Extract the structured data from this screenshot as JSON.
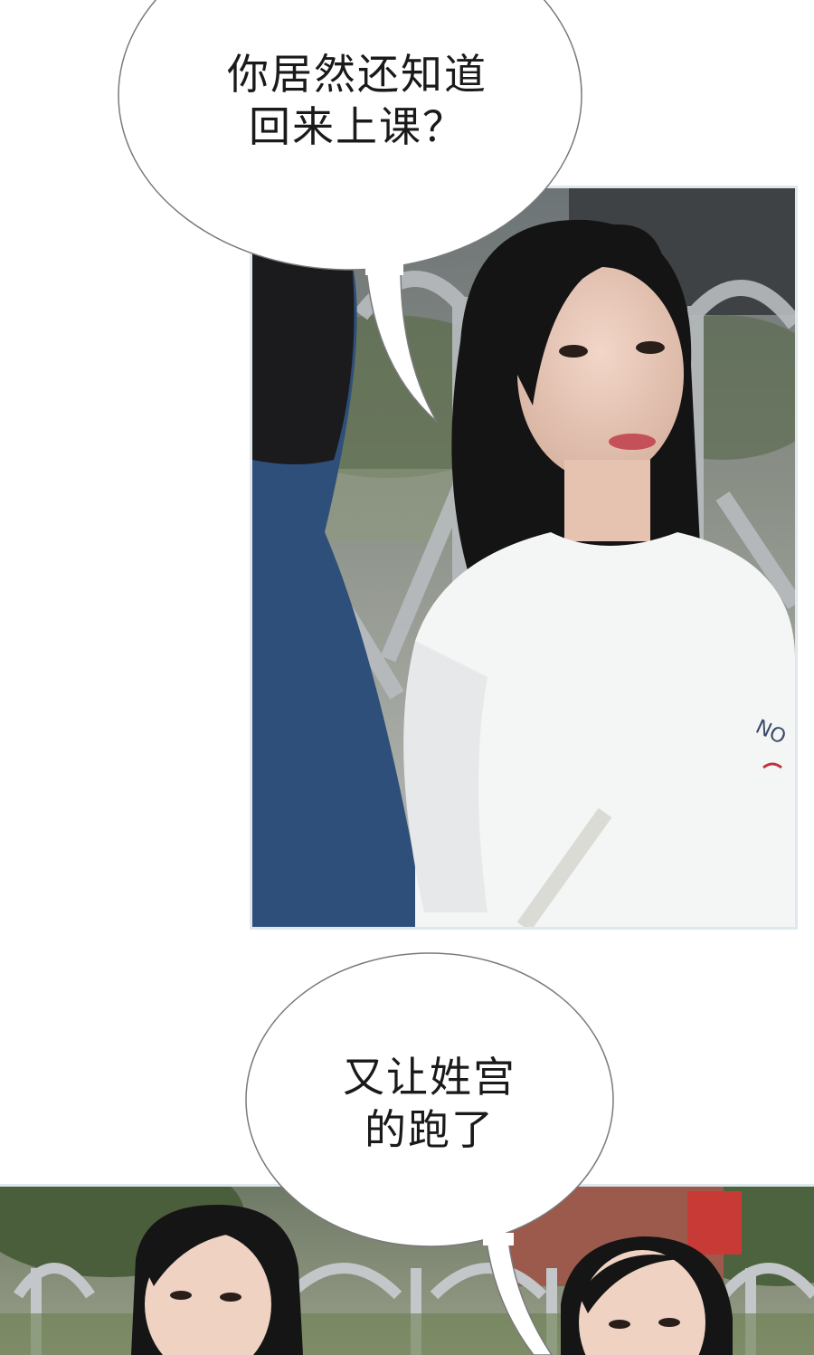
{
  "bubbles": [
    {
      "text": "你居然还知道\n回来上课？"
    },
    {
      "text": "又让姓宫\n的跑了"
    }
  ],
  "photos": [
    {
      "alt": "Girl in white T-shirt glancing sideways near metal gate"
    },
    {
      "alt": "Two girls near a metal gate with trees and buildings behind"
    }
  ],
  "colors": {
    "panel_border": "#dfe8ec",
    "bubble_stroke": "#7a7a7a",
    "background": "#ffffff"
  }
}
